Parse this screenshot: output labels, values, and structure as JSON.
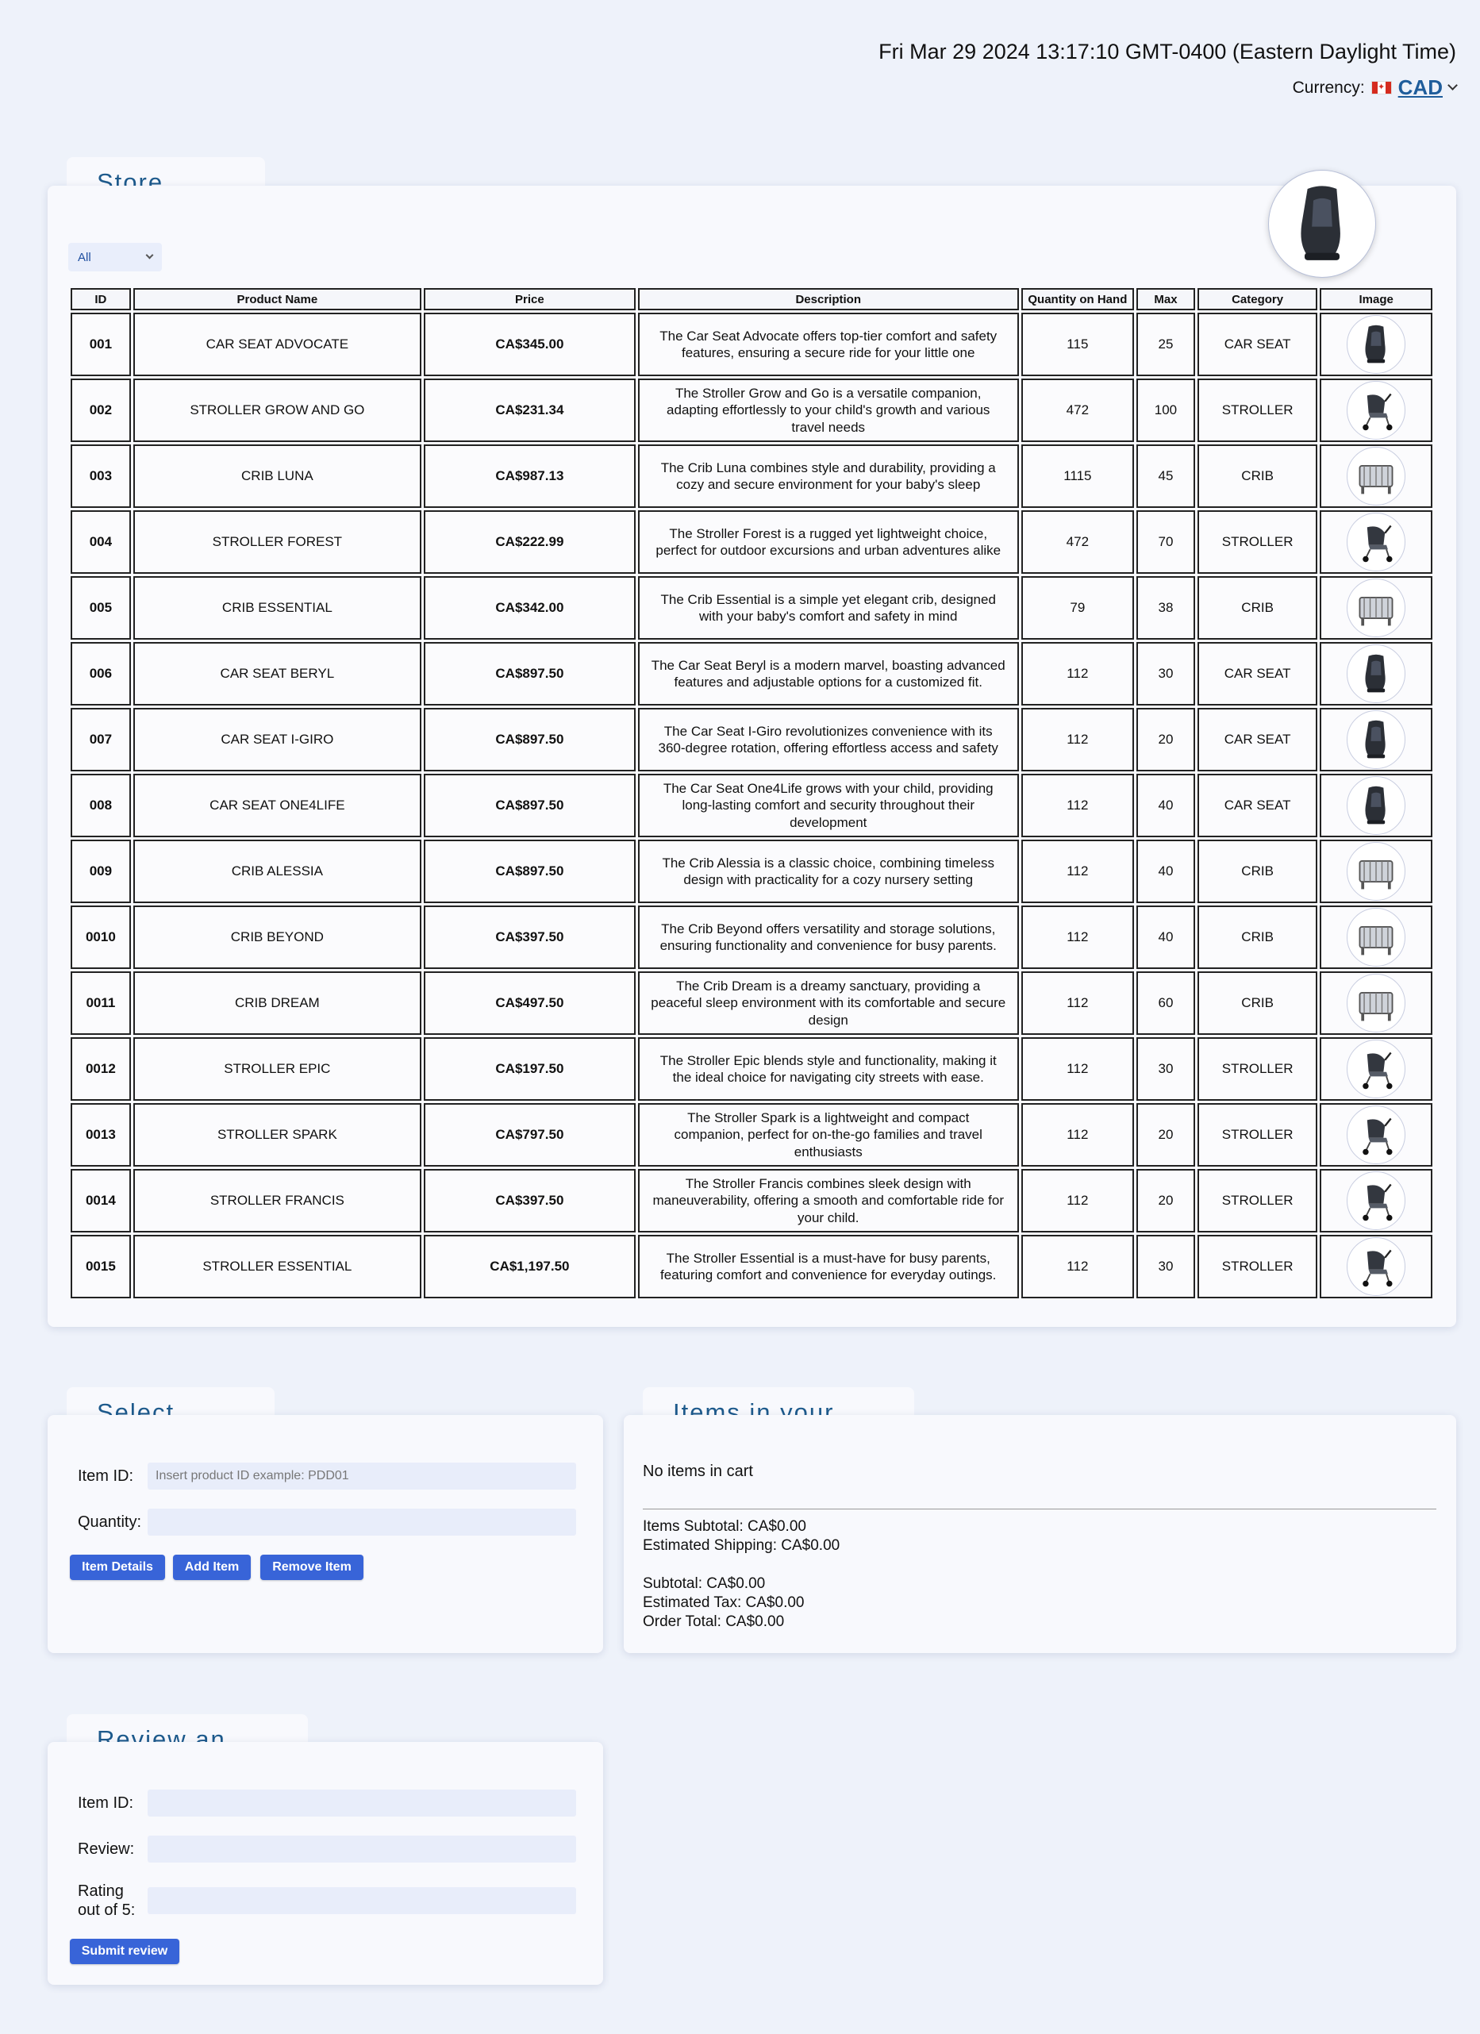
{
  "header": {
    "datetime": "Fri Mar 29 2024 13:17:10 GMT-0400 (Eastern Daylight Time)",
    "currency_label": "Currency:",
    "currency_value": "CAD"
  },
  "store": {
    "title": "Store Items",
    "filter_value": "All",
    "columns": [
      "ID",
      "Product Name",
      "Price",
      "Description",
      "Quantity on Hand",
      "Max",
      "Category",
      "Image"
    ],
    "rows": [
      {
        "id": "001",
        "name": "CAR SEAT ADVOCATE",
        "price": "CA$345.00",
        "desc": "The Car Seat Advocate offers top-tier comfort and safety features, ensuring a secure ride for your little one",
        "qty": "115",
        "max": "25",
        "category": "CAR SEAT",
        "image": "car-seat-icon"
      },
      {
        "id": "002",
        "name": "STROLLER GROW AND GO",
        "price": "CA$231.34",
        "desc": "The Stroller Grow and Go is a versatile companion, adapting effortlessly to your child's growth and various travel needs",
        "qty": "472",
        "max": "100",
        "category": "STROLLER",
        "image": "stroller-icon"
      },
      {
        "id": "003",
        "name": "CRIB LUNA",
        "price": "CA$987.13",
        "desc": "The Crib Luna combines style and durability, providing a cozy and secure environment for your baby's sleep",
        "qty": "1115",
        "max": "45",
        "category": "CRIB",
        "image": "crib-icon"
      },
      {
        "id": "004",
        "name": "STROLLER FOREST",
        "price": "CA$222.99",
        "desc": "The Stroller Forest is a rugged yet lightweight choice, perfect for outdoor excursions and urban adventures alike",
        "qty": "472",
        "max": "70",
        "category": "STROLLER",
        "image": "stroller-icon"
      },
      {
        "id": "005",
        "name": "CRIB ESSENTIAL",
        "price": "CA$342.00",
        "desc": "The Crib Essential is a simple yet elegant crib, designed with your baby's comfort and safety in mind",
        "qty": "79",
        "max": "38",
        "category": "CRIB",
        "image": "crib-icon"
      },
      {
        "id": "006",
        "name": "CAR SEAT BERYL",
        "price": "CA$897.50",
        "desc": "The Car Seat Beryl is a modern marvel, boasting advanced features and adjustable options for a customized fit.",
        "qty": "112",
        "max": "30",
        "category": "CAR SEAT",
        "image": "car-seat-icon"
      },
      {
        "id": "007",
        "name": "CAR SEAT I-GIRO",
        "price": "CA$897.50",
        "desc": "The Car Seat I-Giro revolutionizes convenience with its 360-degree rotation, offering effortless access and safety",
        "qty": "112",
        "max": "20",
        "category": "CAR SEAT",
        "image": "car-seat-icon"
      },
      {
        "id": "008",
        "name": "CAR SEAT ONE4LIFE",
        "price": "CA$897.50",
        "desc": "The Car Seat One4Life grows with your child, providing long-lasting comfort and security throughout their development",
        "qty": "112",
        "max": "40",
        "category": "CAR SEAT",
        "image": "car-seat-icon"
      },
      {
        "id": "009",
        "name": "CRIB ALESSIA",
        "price": "CA$897.50",
        "desc": "The Crib Alessia is a classic choice, combining timeless design with practicality for a cozy nursery setting",
        "qty": "112",
        "max": "40",
        "category": "CRIB",
        "image": "crib-icon"
      },
      {
        "id": "0010",
        "name": "CRIB BEYOND",
        "price": "CA$397.50",
        "desc": "The Crib Beyond offers versatility and storage solutions, ensuring functionality and convenience for busy parents.",
        "qty": "112",
        "max": "40",
        "category": "CRIB",
        "image": "crib-icon"
      },
      {
        "id": "0011",
        "name": "CRIB DREAM",
        "price": "CA$497.50",
        "desc": "The Crib Dream is a dreamy sanctuary, providing a peaceful sleep environment with its comfortable and secure design",
        "qty": "112",
        "max": "60",
        "category": "CRIB",
        "image": "crib-icon"
      },
      {
        "id": "0012",
        "name": "STROLLER EPIC",
        "price": "CA$197.50",
        "desc": "The Stroller Epic blends style and functionality, making it the ideal choice for navigating city streets with ease.",
        "qty": "112",
        "max": "30",
        "category": "STROLLER",
        "image": "stroller-icon"
      },
      {
        "id": "0013",
        "name": "STROLLER SPARK",
        "price": "CA$797.50",
        "desc": "The Stroller Spark is a lightweight and compact companion, perfect for on-the-go families and travel enthusiasts",
        "qty": "112",
        "max": "20",
        "category": "STROLLER",
        "image": "stroller-icon"
      },
      {
        "id": "0014",
        "name": "STROLLER FRANCIS",
        "price": "CA$397.50",
        "desc": "The Stroller Francis combines sleek design with maneuverability, offering a smooth and comfortable ride for your child.",
        "qty": "112",
        "max": "20",
        "category": "STROLLER",
        "image": "stroller-icon"
      },
      {
        "id": "0015",
        "name": "STROLLER ESSENTIAL",
        "price": "CA$1,197.50",
        "desc": "The Stroller Essential is a must-have for busy parents, featuring comfort and convenience for everyday outings.",
        "qty": "112",
        "max": "30",
        "category": "STROLLER",
        "image": "stroller-icon"
      }
    ]
  },
  "select": {
    "title": "Select items",
    "item_id_label": "Item ID:",
    "item_id_placeholder": "Insert product ID example: PDD01",
    "quantity_label": "Quantity:",
    "details_label": "Item Details",
    "add_label": "Add Item",
    "remove_label": "Remove Item"
  },
  "cart": {
    "title": "Items in your cart",
    "empty_text": "No items in cart",
    "items_subtotal": "Items Subtotal: CA$0.00",
    "shipping": "Estimated Shipping: CA$0.00",
    "subtotal": "Subtotal: CA$0.00",
    "tax": "Estimated Tax: CA$0.00",
    "total": "Order Total: CA$0.00"
  },
  "review": {
    "title": "Review an item",
    "item_id_label": "Item ID:",
    "review_label": "Review:",
    "rating_label_1": "Rating",
    "rating_label_2": "out of 5:",
    "submit_label": "Submit review"
  },
  "colors": {
    "background": "#eef2fa",
    "card": "#f8f9fd",
    "title": "#1d5a8c",
    "button": "#3864d8"
  }
}
